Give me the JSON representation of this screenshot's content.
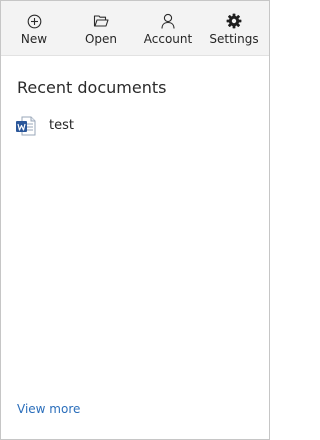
{
  "toolbar": {
    "items": [
      {
        "label": "New",
        "icon": "plus-circle-icon"
      },
      {
        "label": "Open",
        "icon": "folder-open-icon"
      },
      {
        "label": "Account",
        "icon": "person-icon"
      },
      {
        "label": "Settings",
        "icon": "gear-icon"
      }
    ]
  },
  "recent": {
    "title": "Recent documents",
    "documents": [
      {
        "name": "test",
        "icon": "word-document-icon"
      }
    ],
    "view_more_label": "View more"
  },
  "colors": {
    "toolbar_bg": "#f3f3f3",
    "link": "#2a6ebb",
    "word_blue": "#2b579a"
  }
}
